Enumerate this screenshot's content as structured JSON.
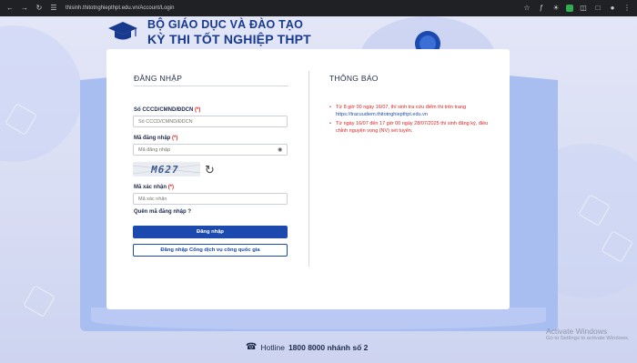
{
  "browser": {
    "url": "thisinh.thitotnghiepthpt.edu.vn/Account/Login",
    "nav_icons": [
      "back-icon",
      "forward-icon",
      "reload-icon",
      "site-info-icon"
    ]
  },
  "header": {
    "line1": "BỘ GIÁO DỤC VÀ ĐÀO TẠO",
    "line2": "KỲ THI TỐT NGHIỆP THPT"
  },
  "login": {
    "title": "ĐĂNG NHẬP",
    "id_label": "Số CCCD/CMND/ĐDCN",
    "id_placeholder": "Số CCCD/CMND/ĐDCN",
    "password_label": "Mã đăng nhập",
    "password_placeholder": "Mã đăng nhập",
    "captcha_text": "M627",
    "captcha_label": "Mã xác nhận",
    "captcha_placeholder": "Mã xác nhận",
    "required_mark": "(*)",
    "forgot": "Quên mã đăng nhập ?",
    "submit": "Đăng nhập",
    "gov_login": "Đăng nhập Cổng dịch vụ công quốc gia"
  },
  "notice": {
    "title": "THÔNG BÁO",
    "item1_text": "Từ 8 giờ 00 ngày 16/07, thí sinh tra cứu điểm thi trên trang",
    "item1_link": "https://tracuudiem.thitotnghiepthpt.edu.vn",
    "item2_text": "Từ ngày 16/07 đến 17 giờ 00 ngày 28/07/2025 thí sinh đăng ký, điều chỉnh nguyện vọng (NV) xét tuyển."
  },
  "hotline": {
    "label": "Hotline",
    "number": "1800 8000 nhánh số 2"
  },
  "watermark": {
    "line1": "Activate Windows",
    "line2": "Go to Settings to activate Windows."
  },
  "colors": {
    "primary": "#1c49ad",
    "brand_text": "#173a8f",
    "required": "#e0231f",
    "book_blue": "#a8bdf0"
  }
}
